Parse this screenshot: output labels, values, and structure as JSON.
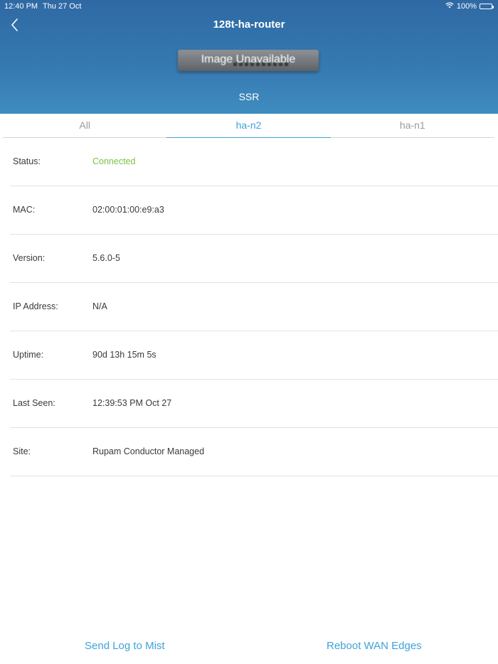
{
  "status_bar": {
    "time": "12:40 PM",
    "date": "Thu 27 Oct",
    "battery_text": "100%",
    "icons": [
      "wifi-icon",
      "battery-icon"
    ]
  },
  "header": {
    "title": "128t-ha-router",
    "back_icon": "chevron-left-icon",
    "device_image_text": "Image Unavailable",
    "device_type": "SSR"
  },
  "tabs": [
    {
      "label": "All",
      "active": false
    },
    {
      "label": "ha-n2",
      "active": true
    },
    {
      "label": "ha-n1",
      "active": false
    }
  ],
  "details": [
    {
      "label": "Status:",
      "value": "Connected"
    },
    {
      "label": "MAC:",
      "value": "02:00:01:00:e9:a3"
    },
    {
      "label": "Version:",
      "value": "5.6.0-5"
    },
    {
      "label": "IP Address:",
      "value": "N/A"
    },
    {
      "label": "Uptime:",
      "value": "90d 13h 15m 5s"
    },
    {
      "label": "Last Seen:",
      "value": "12:39:53 PM Oct 27"
    },
    {
      "label": "Site:",
      "value": "Rupam Conductor Managed"
    }
  ],
  "actions": {
    "send_log": "Send Log to Mist",
    "reboot": "Reboot WAN Edges"
  },
  "colors": {
    "header_top": "#2f69a4",
    "header_bottom": "#3f8cc0",
    "accent": "#3da4d8",
    "status_connected": "#7cc142"
  }
}
